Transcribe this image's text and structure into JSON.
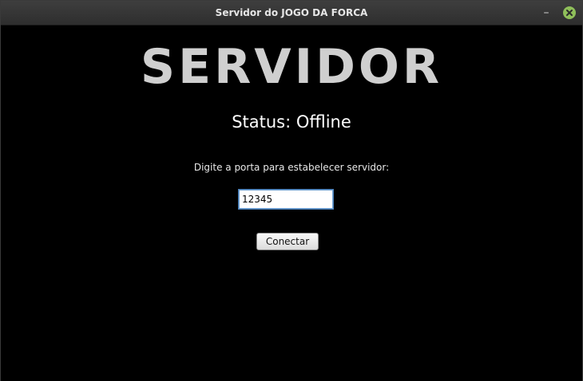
{
  "window": {
    "title": "Servidor do JOGO DA FORCA",
    "minimize_glyph": "–",
    "close_icon": "close-icon"
  },
  "main": {
    "heading": "SERVIDOR",
    "status": "Status: Offline",
    "port_prompt": "Digite a porta para estabelecer servidor:",
    "port_value": "12345",
    "connect_label": "Conectar"
  },
  "colors": {
    "background": "#000000",
    "titlebar": "#363636",
    "heading": "#cfcfcf",
    "close_button": "#8fbf5a"
  }
}
